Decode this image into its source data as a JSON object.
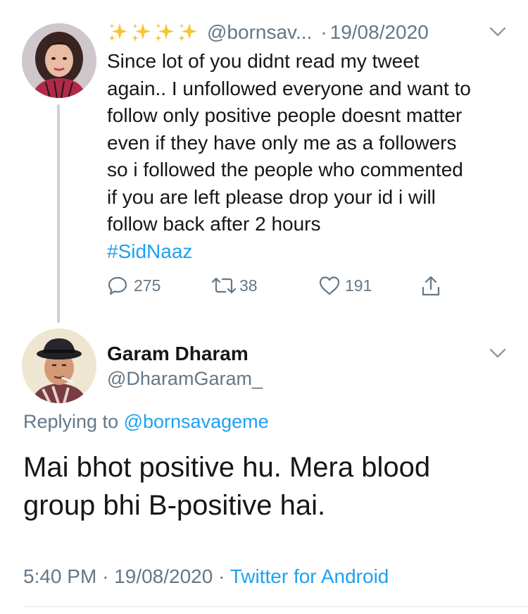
{
  "parent_tweet": {
    "sparkles_icon": "sparkles-emoji-icon",
    "handle": "@bornsav...",
    "separator": "·",
    "date": "19/08/2020",
    "text_lines": [
      "Since lot of you didnt read my tweet",
      "again.. I unfollowed everyone and want to",
      "follow only positive people doesnt matter",
      "even if they have only me as a followers",
      "so i followed the people who commented",
      "if you are left please drop your id i will",
      "follow back after 2 hours"
    ],
    "hashtag": "#SidNaaz",
    "actions": {
      "replies": "275",
      "retweets": "38",
      "likes": "191"
    }
  },
  "reply_tweet": {
    "display_name": "Garam Dharam",
    "handle": "@DharamGaram_",
    "replying_prefix": "Replying to",
    "replying_to": "@bornsavageme",
    "text_lines": [
      "Mai bhot positive hu. Mera blood",
      "group bhi B-positive hai."
    ],
    "time": "5:40 PM",
    "separator": "·",
    "date": "19/08/2020",
    "source": "Twitter for Android"
  },
  "colors": {
    "link": "#1da1f2",
    "secondary_text": "#657786",
    "primary_text": "#14171a",
    "thread_line": "#c9d1d8"
  }
}
